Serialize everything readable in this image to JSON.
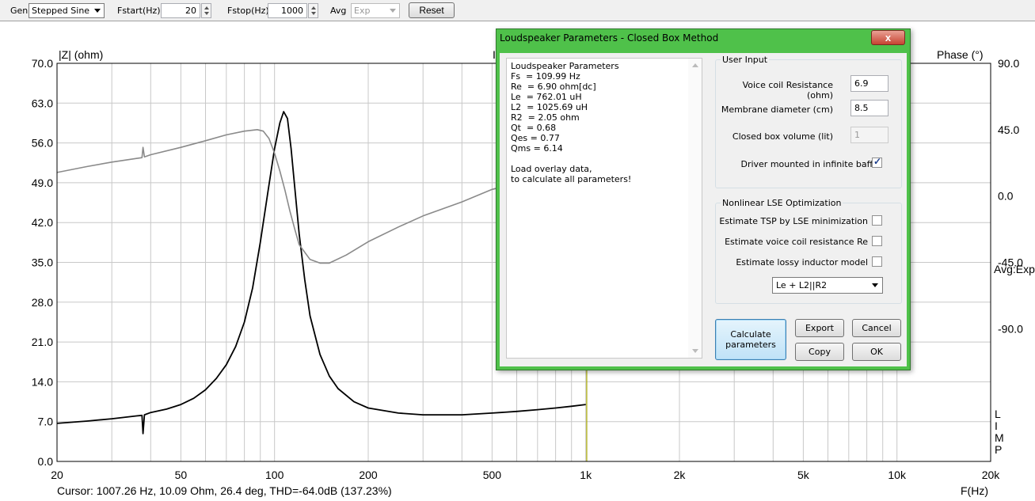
{
  "toolbar": {
    "gen_label": "Gen",
    "gen_value": "Stepped Sine",
    "fstart_label": "Fstart(Hz)",
    "fstart_value": "20",
    "fstop_label": "Fstop(Hz)",
    "fstop_value": "1000",
    "avg_label": "Avg",
    "avg_value": "Exp",
    "reset_label": "Reset"
  },
  "plot": {
    "left_axis_title": "|Z| (ohm)",
    "right_axis_title": "Phase (°)",
    "right_avg_label": "Avg:Exp",
    "limp_letters": [
      "L",
      "I",
      "M",
      "P"
    ],
    "overlay_hidden_title_fragment": "I",
    "cursor_status": "Cursor: 1007.26 Hz, 10.09 Ohm, 26.4 deg, THD=-64.0dB (137.23%)",
    "x_axis_unit": "F(Hz)",
    "colors": {
      "impedance": "#000000",
      "phase": "#8a8a8a",
      "cursor": "#a8a800",
      "grid": "#c8c8c8"
    }
  },
  "chart_data": {
    "type": "line",
    "xscale": "log",
    "xlim": [
      20,
      20000
    ],
    "ylim": [
      0,
      70
    ],
    "y2lim": [
      -180,
      90
    ],
    "x_tick_labels": [
      "20",
      "50",
      "100",
      "200",
      "500",
      "1k",
      "2k",
      "5k",
      "10k",
      "20k"
    ],
    "x_tick_values": [
      20,
      50,
      100,
      200,
      500,
      1000,
      2000,
      5000,
      10000,
      20000
    ],
    "y_tick_labels": [
      "70.0",
      "63.0",
      "56.0",
      "49.0",
      "42.0",
      "35.0",
      "28.0",
      "21.0",
      "14.0",
      "7.0",
      "0.0"
    ],
    "y2_tick_labels": [
      "90.0",
      "45.0",
      "0.0",
      "-45.0",
      "-90.0"
    ],
    "y2_tick_values": [
      90,
      45,
      0,
      -45,
      -90
    ],
    "cursor_x": 1007.26,
    "series": [
      {
        "name": "|Z| (ohm)",
        "axis": "left",
        "x": [
          20,
          25,
          30,
          36,
          37.5,
          37.8,
          38.2,
          40,
          45,
          50,
          55,
          60,
          65,
          70,
          75,
          80,
          85,
          90,
          95,
          100,
          104,
          107,
          110,
          113,
          116,
          120,
          125,
          130,
          140,
          150,
          160,
          180,
          200,
          250,
          300,
          400,
          500,
          600,
          700,
          800,
          900,
          1000
        ],
        "y": [
          6.7,
          7.1,
          7.5,
          8.0,
          8.1,
          4.9,
          8.2,
          8.6,
          9.2,
          10.0,
          11.1,
          12.6,
          14.6,
          17.0,
          20.2,
          24.5,
          30.5,
          38.5,
          47.0,
          55.0,
          59.5,
          61.5,
          60.3,
          55.0,
          48.5,
          40.0,
          32.0,
          25.6,
          18.8,
          15.0,
          12.8,
          10.5,
          9.4,
          8.5,
          8.2,
          8.2,
          8.5,
          8.8,
          9.1,
          9.4,
          9.7,
          10.0
        ]
      },
      {
        "name": "Phase (°)",
        "axis": "right",
        "x": [
          20,
          25,
          30,
          36,
          37.5,
          37.8,
          38.2,
          40,
          50,
          60,
          70,
          80,
          88,
          92,
          96,
          100,
          104,
          108,
          112,
          116,
          120,
          130,
          140,
          150,
          170,
          200,
          250,
          300,
          400,
          500,
          560
        ],
        "y": [
          16,
          20,
          23,
          25.5,
          26,
          33,
          26.5,
          28,
          33,
          37.5,
          41.5,
          44,
          45,
          44,
          39,
          29,
          17,
          4,
          -10,
          -22,
          -33,
          -43,
          -45.5,
          -45.5,
          -40,
          -31,
          -21,
          -13.5,
          -4,
          4.5,
          7
        ]
      }
    ]
  },
  "dialog": {
    "title": "Loudspeaker Parameters - Closed Box Method",
    "close_symbol": "x",
    "results_lines": [
      "Loudspeaker Parameters",
      "Fs  = 109.99 Hz",
      "Re  = 6.90 ohm[dc]",
      "Le  = 762.01 uH",
      "L2  = 1025.69 uH",
      "R2  = 2.05 ohm",
      "Qt  = 0.68",
      "Qes = 0.77",
      "Qms = 6.14",
      "",
      "Load overlay data,",
      "to calculate all parameters!"
    ],
    "user_input": {
      "title": "User Input",
      "voice_coil_label": "Voice coil Resistance (ohm)",
      "voice_coil_value": "6.9",
      "membrane_label": "Membrane diameter (cm)",
      "membrane_value": "8.5",
      "box_volume_label": "Closed box volume (lit)",
      "box_volume_value": "1",
      "infinite_baffle_label": "Driver mounted in infinite baffle",
      "infinite_baffle_checked": true
    },
    "lse": {
      "title": "Nonlinear LSE Optimization",
      "estimate_tsp_label": "Estimate TSP by LSE minimization",
      "estimate_re_label": "Estimate voice coil resistance Re",
      "estimate_lossy_label": "Estimate lossy inductor model",
      "model_value": "Le + L2||R2"
    },
    "buttons": {
      "calculate_line1": "Calculate",
      "calculate_line2": "parameters",
      "export": "Export",
      "cancel": "Cancel",
      "copy": "Copy",
      "ok": "OK"
    }
  }
}
